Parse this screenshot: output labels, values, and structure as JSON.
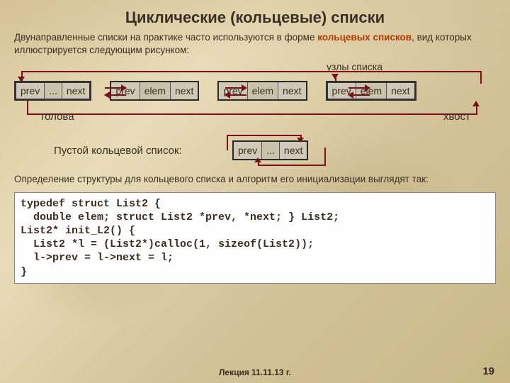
{
  "title": "Циклические (кольцевые) списки",
  "intro_1": "Двунаправленные списки на практике часто используются в форме ",
  "intro_kw": "кольцевых списков",
  "intro_2": ", вид которых иллюстрируется следующим рисунком:",
  "labels": {
    "nodes": "узлы списка",
    "head": "голова",
    "tail": "хвост",
    "empty": "Пустой кольцевой список:"
  },
  "cells": {
    "prev": "prev",
    "elem": "elem",
    "dots": "...",
    "next": "next"
  },
  "def_1": "Определение структуры для кольцевого списка и алгоритм его инициализации выглядят так:",
  "code": "typedef struct List2 {\n  double elem; struct List2 *prev, *next; } List2;\nList2* init_L2() {\n  List2 *l = (List2*)calloc(1, sizeof(List2));\n  l->prev = l->next = l;\n}",
  "footer": "Лекция  11.11.13 г.",
  "page": "19"
}
